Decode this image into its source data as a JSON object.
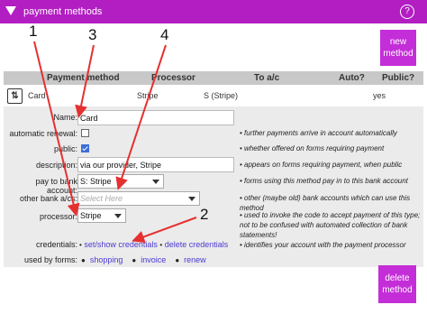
{
  "header": {
    "title": "payment methods",
    "help": "?"
  },
  "buttons": {
    "new_line1": "new",
    "new_line2": "method",
    "delete_line1": "delete",
    "delete_line2": "method"
  },
  "table": {
    "columns": [
      "Payment method",
      "Processor",
      "To a/c",
      "Auto?",
      "Public?"
    ],
    "row": {
      "sort": "⇅",
      "method": "Card",
      "processor": "Stripe",
      "account": "S (Stripe)",
      "public": "yes"
    }
  },
  "form": {
    "name": {
      "label": "Name:",
      "value": "Card"
    },
    "auto_renewal": {
      "label": "automatic renewal:"
    },
    "public": {
      "label": "public:"
    },
    "description": {
      "label": "description:",
      "value": "via our provider, Stripe"
    },
    "pay_to": {
      "label": "pay to bank account:",
      "value": "S: Stripe"
    },
    "other_bank": {
      "label": "other bank a/cs:",
      "placeholder": "Select Here"
    },
    "processor": {
      "label": "processor:",
      "value": "Stripe"
    },
    "credentials": {
      "label": "credentials:",
      "set_link": "set/show credentials",
      "delete_link": "delete credentials",
      "sep": "•"
    },
    "used_by": {
      "label": "used by forms:",
      "forms": [
        "shopping",
        "invoice",
        "renew"
      ]
    }
  },
  "notes": [
    "• further payments arrive in account automatically",
    "• whether offered on forms requiring payment",
    "• appears on forms requiring payment, when public",
    "• forms using this method pay in to this bank account",
    "• other (maybe old) bank accounts which can use this method",
    "• used to invoke the code to accept payment of this type; not to be confused with automated collection of bank statements!",
    "• identifies your account with the payment processor"
  ],
  "annotations": [
    "1",
    "2",
    "3",
    "4"
  ],
  "colors": {
    "brand": "#b21ec2",
    "button": "#c42ed8",
    "arrow": "#e53030",
    "link": "#4a3ad0"
  }
}
